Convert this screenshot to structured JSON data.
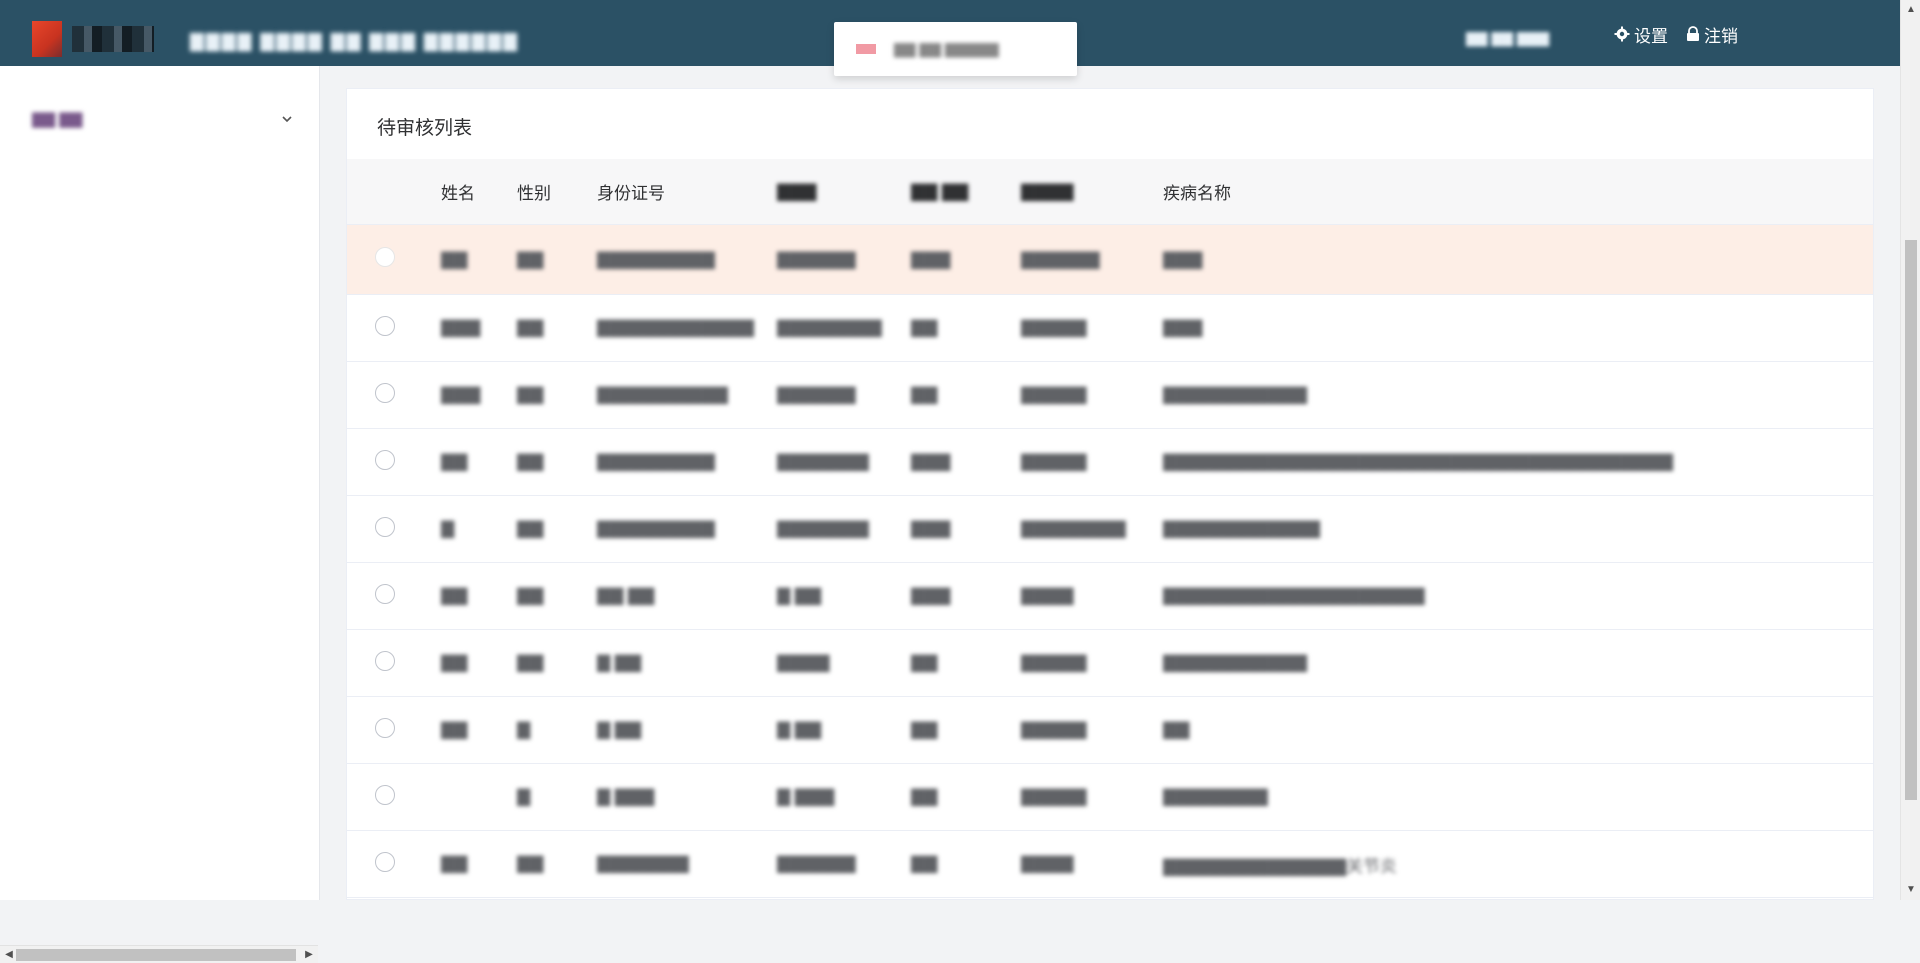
{
  "header": {
    "system_name": "▇▇▇▇ ▇▇▇▇ ▇▇ ▇▇▇ ▇▇▇▇▇▇",
    "notice": "▇▇ ▇▇ ▇▇▇▇▇",
    "user": "▇▇ ▇▇ ▇▇▇",
    "settings_label": "设置",
    "logout_label": "注销",
    "colors": {
      "bg": "#2b5165",
      "text": "#ffffff"
    },
    "icons": [
      "gear-icon",
      "lock-icon"
    ]
  },
  "sidebar": {
    "menu_group_label": "▇▇ ▇▇",
    "icon": "chevron-down-icon"
  },
  "main": {
    "title": "待审核列表",
    "columns": {
      "name": "姓名",
      "sex": "性别",
      "id": "身份证号",
      "c4": "▇▇▇",
      "c5": "▇▇ ▇▇",
      "c6": "▇▇▇▇",
      "disease": "疾病名称"
    },
    "rows": [
      {
        "name": "▇▇",
        "sex": "▇▇",
        "id": "▇▇▇▇▇▇▇▇▇",
        "c4": "▇▇▇▇▇▇",
        "c5": "▇▇▇",
        "c6": "▇▇▇▇▇▇",
        "disease": "▇▇▇"
      },
      {
        "name": "▇▇▇",
        "sex": "▇▇",
        "id": "▇▇▇▇▇▇▇▇▇▇▇▇",
        "c4": "▇▇▇▇▇▇▇▇",
        "c5": "▇▇",
        "c6": "▇▇▇▇▇",
        "disease": "▇▇▇"
      },
      {
        "name": "▇▇▇",
        "sex": "▇▇",
        "id": "▇▇▇▇▇▇▇▇▇▇",
        "c4": "▇▇▇▇▇▇",
        "c5": "▇▇",
        "c6": "▇▇▇▇▇",
        "disease": "▇▇▇▇▇▇▇▇▇▇▇"
      },
      {
        "name": "▇▇",
        "sex": "▇▇",
        "id": "▇▇▇▇▇▇▇▇▇",
        "c4": "▇▇▇▇▇▇▇",
        "c5": "▇▇▇",
        "c6": "▇▇▇▇▇",
        "disease": "▇▇▇▇▇▇▇▇▇▇▇▇▇▇▇▇▇▇▇▇▇▇▇▇▇▇▇▇▇▇▇▇▇▇▇▇▇▇▇"
      },
      {
        "name": "▇",
        "sex": "▇▇",
        "id": "▇▇▇▇▇▇▇▇▇",
        "c4": "▇▇▇▇▇▇▇",
        "c5": "▇▇▇",
        "c6": "▇▇▇▇▇▇▇▇",
        "disease": "▇▇▇▇▇▇▇▇▇▇▇▇"
      },
      {
        "name": "▇▇",
        "sex": "▇▇",
        "id": "▇▇  ▇▇",
        "c4": "▇ ▇▇",
        "c5": "▇▇▇",
        "c6": "▇▇▇▇",
        "disease": "▇▇▇▇▇▇▇▇▇▇▇▇▇▇▇▇▇▇▇▇"
      },
      {
        "name": "▇▇",
        "sex": "▇▇",
        "id": "▇  ▇▇",
        "c4": "▇▇▇▇",
        "c5": "▇▇",
        "c6": "▇▇▇▇▇",
        "disease": "▇▇▇▇▇▇▇▇▇▇▇"
      },
      {
        "name": "▇▇",
        "sex": "▇",
        "id": "▇  ▇▇",
        "c4": "▇ ▇▇",
        "c5": "▇▇",
        "c6": "▇▇▇▇▇",
        "disease": "▇▇"
      },
      {
        "name": "",
        "sex": "▇",
        "id": "▇ ▇▇▇",
        "c4": "▇ ▇▇▇",
        "c5": "▇▇",
        "c6": "▇▇▇▇▇",
        "disease": "▇▇▇▇▇▇▇▇"
      },
      {
        "name": "▇▇",
        "sex": "▇▇",
        "id": "▇▇▇▇▇▇▇",
        "c4": "▇▇▇▇▇▇",
        "c5": "▇▇",
        "c6": "▇▇▇▇",
        "disease": "▇▇▇▇▇▇▇▇▇▇▇▇▇▇关节炎"
      }
    ],
    "selected_row": 0
  }
}
